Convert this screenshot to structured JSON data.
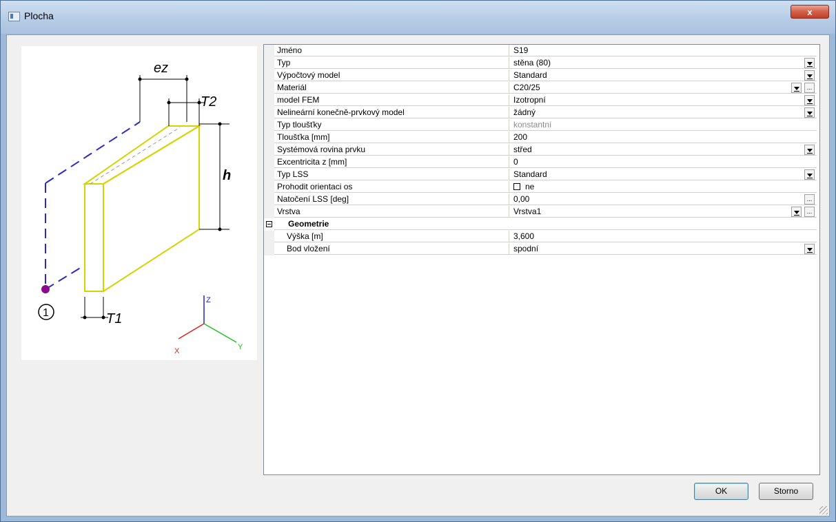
{
  "window": {
    "title": "Plocha",
    "close_label": "x"
  },
  "diagram": {
    "labels": {
      "ez": "ez",
      "t2": "T2",
      "h": "h",
      "t1": "T1",
      "node": "1"
    },
    "axes": {
      "z": "Z",
      "x": "X",
      "y": "Y"
    },
    "colors": {
      "outline": "#d4d400",
      "dashed": "#2a2ac8",
      "node": "#8a0a8a",
      "axis_x": "#e02020",
      "axis_y": "#20c020",
      "axis_z": "#2020e0"
    }
  },
  "properties": [
    {
      "name": "Jméno",
      "value": "S19"
    },
    {
      "name": "Typ",
      "value": "stěna (80)",
      "control": "dropdown"
    },
    {
      "name": "Výpočtový model",
      "value": "Standard",
      "control": "dropdown"
    },
    {
      "name": "Materiál",
      "value": "C20/25",
      "control": "dropdown-ellipsis"
    },
    {
      "name": "model FEM",
      "value": "Izotropní",
      "control": "dropdown"
    },
    {
      "name": "Nelineární konečně-prvkový model",
      "value": "žádný",
      "control": "dropdown"
    },
    {
      "name": "Typ tloušťky",
      "value": "konstantní",
      "control": "disabled"
    },
    {
      "name": "Tloušťka [mm]",
      "value": "200"
    },
    {
      "name": "Systémová rovina prvku",
      "value": "střed",
      "control": "dropdown"
    },
    {
      "name": "Excentricita z [mm]",
      "value": "0"
    },
    {
      "name": "Typ LSS",
      "value": "Standard",
      "control": "dropdown"
    },
    {
      "name": "Prohodit orientaci os",
      "value": "ne",
      "control": "checkbox"
    },
    {
      "name": "Natočení LSS [deg]",
      "value": "0,00",
      "control": "ellipsis"
    },
    {
      "name": "Vrstva",
      "value": "Vrstva1",
      "control": "dropdown-ellipsis"
    }
  ],
  "geometry": {
    "category": "Geometrie",
    "items": [
      {
        "name": "Výška [m]",
        "value": "3,600"
      },
      {
        "name": "Bod vložení",
        "value": "spodní",
        "control": "dropdown"
      }
    ]
  },
  "buttons": {
    "ok": "OK",
    "cancel": "Storno"
  }
}
